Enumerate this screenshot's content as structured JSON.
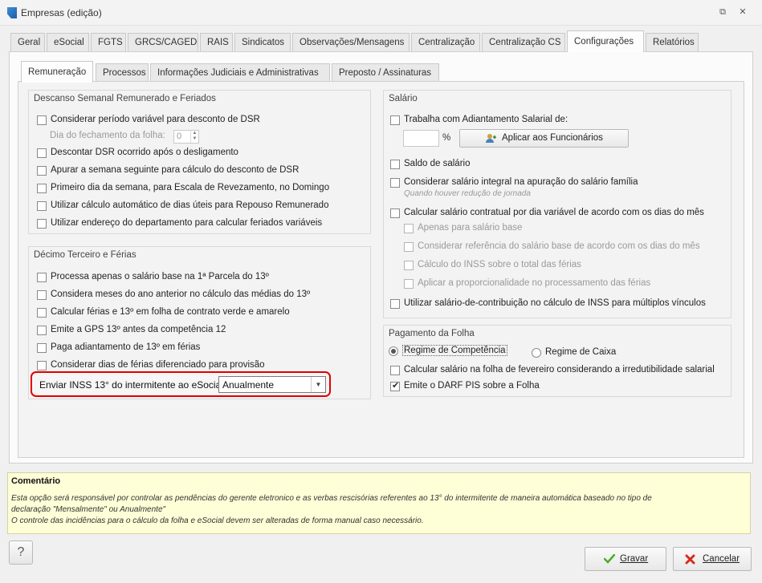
{
  "window": {
    "title": "Empresas (edição)",
    "restore_glyph": "⧉",
    "close_glyph": "✕"
  },
  "tabs": [
    {
      "label": "Geral"
    },
    {
      "label": "eSocial"
    },
    {
      "label": "FGTS"
    },
    {
      "label": "GRCS/CAGED"
    },
    {
      "label": "RAIS"
    },
    {
      "label": "Sindicatos"
    },
    {
      "label": "Observações/Mensagens"
    },
    {
      "label": "Centralização"
    },
    {
      "label": "Centralização CS"
    },
    {
      "label": "Configurações"
    },
    {
      "label": "Relatórios"
    }
  ],
  "subtabs": [
    {
      "label": "Remuneração"
    },
    {
      "label": "Processos"
    },
    {
      "label": "Informações Judiciais e Administrativas"
    },
    {
      "label": "Preposto / Assinaturas"
    }
  ],
  "dsr": {
    "title": "Descanso Semanal Remunerado e Feriados",
    "items": [
      "Considerar período variável para desconto de DSR",
      "Descontar DSR ocorrido após o desligamento",
      "Apurar a semana seguinte para cálculo do desconto de DSR",
      "Primeiro dia da semana, para Escala de Revezamento, no Domingo",
      "Utilizar cálculo automático de dias úteis para Repouso Remunerado",
      "Utilizar endereço do departamento para calcular feriados variáveis"
    ],
    "closing_day_label": "Dia do fechamento da folha:",
    "closing_day_value": "0"
  },
  "decimo": {
    "title": "Décimo Terceiro e Férias",
    "items": [
      "Processa apenas o salário base na 1ª Parcela do 13º",
      "Considera meses do ano anterior no cálculo das médias do 13º",
      "Calcular férias e 13º em folha de contrato verde e amarelo",
      "Emite a GPS 13º antes da competência 12",
      "Paga adiantamento de 13º em férias",
      "Considerar dias de férias diferenciado para provisão"
    ],
    "inss_label": "Enviar INSS 13° do intermitente ao eSocial",
    "inss_value": "Anualmente"
  },
  "salario": {
    "title": "Salário",
    "adiantamento": "Trabalha com Adiantamento Salarial de:",
    "percent": "%",
    "apply_button": "Aplicar aos Funcionários",
    "saldo": "Saldo de salário",
    "integral": "Considerar salário integral na apuração do salário família",
    "integral_note": "Quando houver redução de jornada",
    "contratual": "Calcular salário contratual por dia variável de acordo com os dias do mês",
    "sub_items": [
      "Apenas para salário base",
      "Considerar referência do salário base de acordo com os dias do mês",
      "Cálculo do INSS sobre o total das férias",
      "Aplicar a proporcionalidade no processamento das férias"
    ],
    "contribuicao": "Utilizar salário-de-contribuição no cálculo de INSS para múltiplos vínculos"
  },
  "pagamento": {
    "title": "Pagamento da Folha",
    "regime_competencia": "Regime de Competência",
    "regime_caixa": "Regime de Caixa",
    "fevereiro": "Calcular salário na folha de fevereiro considerando a irredutibilidade salarial",
    "darf": "Emite o DARF PIS sobre a Folha"
  },
  "comment": {
    "title": "Comentário",
    "line1": "Esta opção será responsável por controlar as pendências do gerente eletronico e as verbas rescisórias referentes ao 13° do intermitente de maneira automática baseado no tipo de",
    "line2": "declaração \"Mensalmente\" ou Anualmente\"",
    "line3": "O controle das incidências para o cálculo da folha e eSocial devem ser alteradas de forma manual caso necessário."
  },
  "buttons": {
    "help": "?",
    "save": "Gravar",
    "cancel": "Cancelar"
  },
  "colors": {
    "highlight": "#e00000",
    "comment_bg": "#fefed7",
    "save_check": "#4caf28",
    "cancel_x": "#d62b1f"
  }
}
